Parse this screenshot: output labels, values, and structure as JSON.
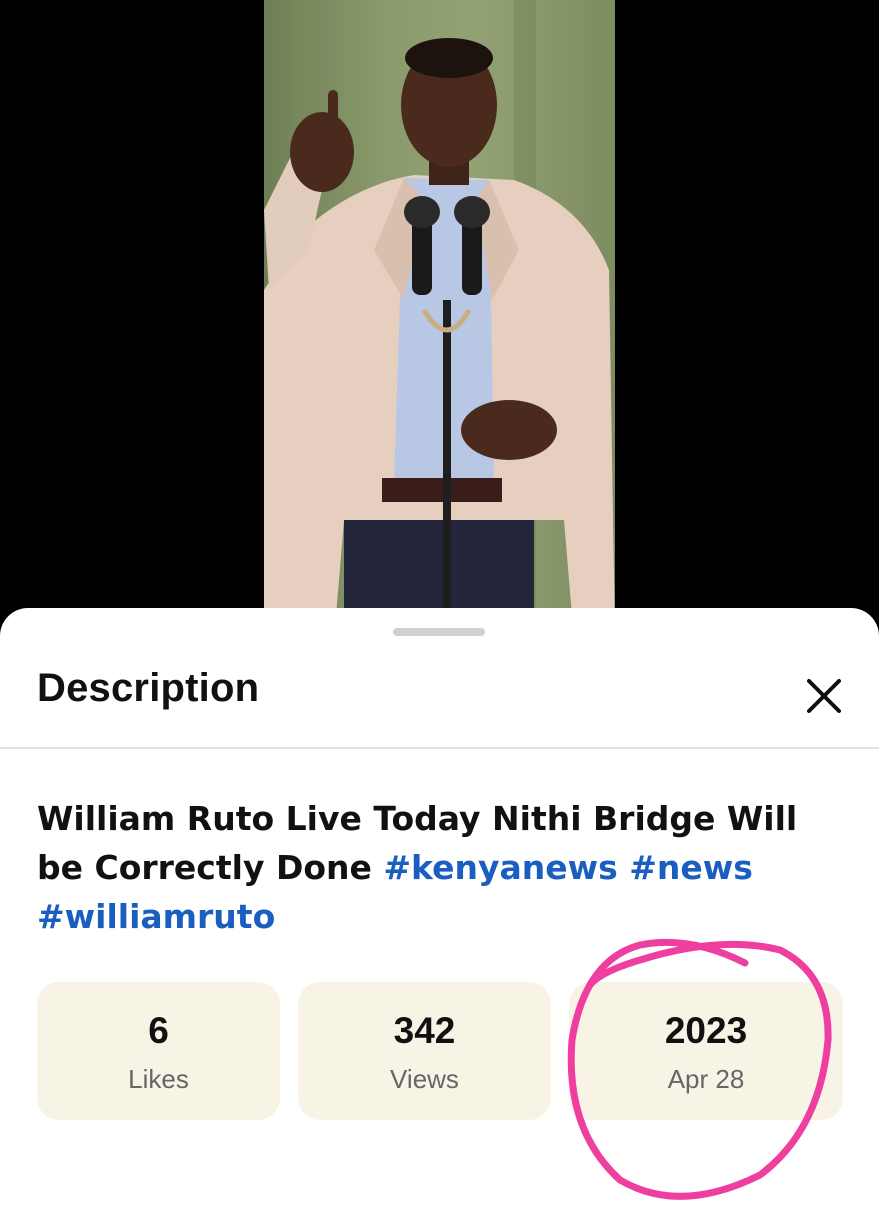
{
  "sheet": {
    "title": "Description",
    "close_icon": "close-icon"
  },
  "description": {
    "text": "William Ruto Live Today Nithi Bridge Will be Correctly Done ",
    "hashtags": [
      "#kenyanews",
      "#news",
      "#williamruto"
    ]
  },
  "stats": [
    {
      "value": "6",
      "label": "Likes"
    },
    {
      "value": "342",
      "label": "Views"
    },
    {
      "value": "2023",
      "label": "Apr 28"
    }
  ],
  "colors": {
    "hashtag": "#1a5fc0",
    "stat_background": "#f7f4e6",
    "annotation_circle": "#ee3fa0"
  }
}
